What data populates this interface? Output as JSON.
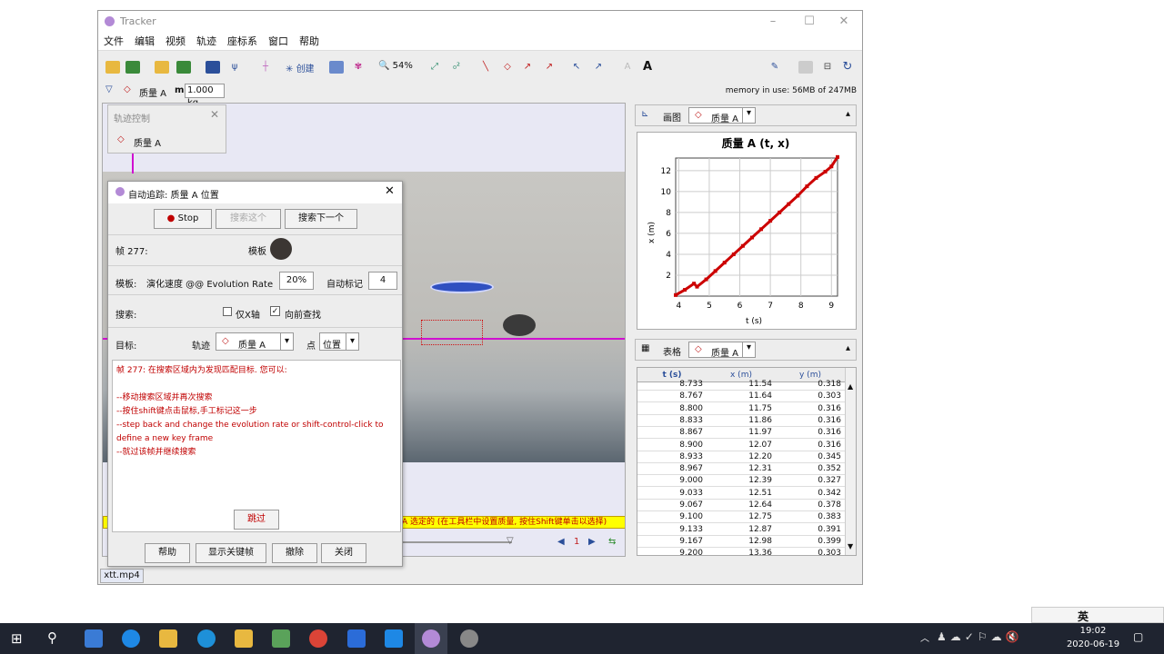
{
  "window": {
    "title": "Tracker"
  },
  "menu": [
    "文件",
    "编辑",
    "视频",
    "轨迹",
    "座标系",
    "窗口",
    "帮助"
  ],
  "toolbar": {
    "create_label": "创建",
    "zoom_label": "54%"
  },
  "subbar": {
    "track_name": "质量 A",
    "mass_label": "m",
    "mass_value": "1.000 kg",
    "memory": "memory in use: 56MB of 247MB"
  },
  "track_control": {
    "title": "轨迹控制",
    "item": "质量 A"
  },
  "autotracker": {
    "title": "自动追踪: 质量 A 位置",
    "stop": "Stop",
    "search_this": "搜索这个",
    "search_next": "搜索下一个",
    "frame_label": "帧 277:",
    "template_label": "模板",
    "template_row_label": "模板:",
    "evolution_label": "演化速度 @@ Evolution Rate",
    "evolution_value": "20%",
    "automark_label": "自动标记",
    "automark_value": "4",
    "search_label": "搜索:",
    "x_only": "仅X轴",
    "look_ahead": "向前查找",
    "target_label": "目标:",
    "track_label": "轨迹",
    "track_value": "质量 A",
    "point_label": "点",
    "point_value": "位置",
    "messages": [
      "帧 277: 在搜索区域内为发现匹配目标. 您可以:",
      "",
      "--移动搜索区域并再次搜索",
      "--按住shift键点击鼠标,手工标记这一步",
      "--step back and change the evolution rate or shift-control-click to define a new key frame",
      "--就过该帧并继续搜索"
    ],
    "skip": "跳过",
    "help": "帮助",
    "show_keyframes": "显示关键帧",
    "delete": "撤除",
    "close": "关闭"
  },
  "status": {
    "hint": "A 选定的 (在工具栏中设置质量, 按住Shift键单击以选择)",
    "frame_no": "1"
  },
  "video_file": "xtt.mp4",
  "plot_panel": {
    "header": "画图",
    "track": "质量 A"
  },
  "table_panel": {
    "header": "表格",
    "track": "质量 A",
    "columns": [
      "t (s)",
      "x (m)",
      "y (m)"
    ],
    "rows": [
      [
        "8.733",
        "11.54",
        "0.318"
      ],
      [
        "8.767",
        "11.64",
        "0.303"
      ],
      [
        "8.800",
        "11.75",
        "0.316"
      ],
      [
        "8.833",
        "11.86",
        "0.316"
      ],
      [
        "8.867",
        "11.97",
        "0.316"
      ],
      [
        "8.900",
        "12.07",
        "0.316"
      ],
      [
        "8.933",
        "12.20",
        "0.345"
      ],
      [
        "8.967",
        "12.31",
        "0.352"
      ],
      [
        "9.000",
        "12.39",
        "0.327"
      ],
      [
        "9.033",
        "12.51",
        "0.342"
      ],
      [
        "9.067",
        "12.64",
        "0.378"
      ],
      [
        "9.100",
        "12.75",
        "0.383"
      ],
      [
        "9.133",
        "12.87",
        "0.391"
      ],
      [
        "9.167",
        "12.98",
        "0.399"
      ],
      [
        "9.200",
        "13.36",
        "0.303"
      ]
    ]
  },
  "chart_data": {
    "type": "scatter",
    "title": "质量 A (t, x)",
    "xlabel": "t (s)",
    "ylabel": "x (m)",
    "xlim": [
      3.9,
      9.2
    ],
    "ylim": [
      0,
      13.2
    ],
    "xticks": [
      4,
      5,
      6,
      7,
      8,
      9
    ],
    "yticks": [
      2,
      4,
      6,
      8,
      10,
      12
    ],
    "grid": true,
    "color": "#cc0000",
    "series": [
      {
        "x": [
          3.9,
          4.2,
          4.5,
          4.6,
          4.9,
          5.2,
          5.5,
          5.8,
          6.1,
          6.4,
          6.7,
          7.0,
          7.3,
          7.6,
          7.9,
          8.2,
          8.5,
          8.8,
          9.0,
          9.2
        ],
        "y": [
          0.1,
          0.6,
          1.2,
          0.9,
          1.6,
          2.4,
          3.2,
          4.0,
          4.8,
          5.6,
          6.4,
          7.2,
          8.0,
          8.8,
          9.6,
          10.5,
          11.3,
          11.9,
          12.4,
          13.3
        ]
      }
    ]
  },
  "taskbar": {
    "ime": "英",
    "time": "19:02",
    "date": "2020-06-19"
  }
}
